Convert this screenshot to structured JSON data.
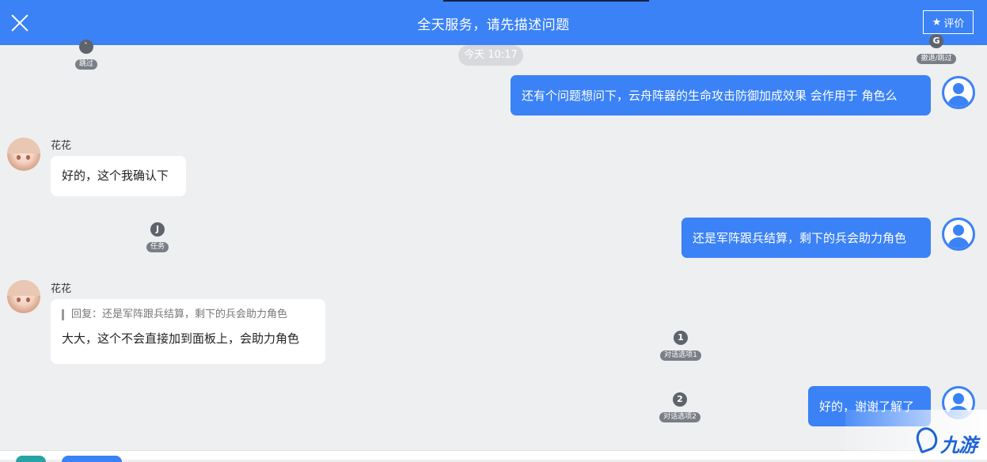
{
  "header": {
    "title": "全天服务，请先描述问题",
    "rate_label": "评价",
    "accent": "#3b82f6"
  },
  "timestamp": "今天 10:17",
  "markers": [
    {
      "key": "`",
      "label": "跳过"
    },
    {
      "key": "G",
      "label": "撤退/跳过"
    },
    {
      "key": "J",
      "label": "任务"
    },
    {
      "key": "1",
      "label": "对话选项1"
    },
    {
      "key": "2",
      "label": "对话选项2"
    }
  ],
  "messages": [
    {
      "sender": "user",
      "text": "还有个问题想问下，云舟阵器的生命攻击防御加成效果 会作用于 角色么"
    },
    {
      "sender": "agent",
      "name": "花花",
      "text": "好的，这个我确认下"
    },
    {
      "sender": "user",
      "text": "还是军阵跟兵结算，剩下的兵会助力角色"
    },
    {
      "sender": "agent",
      "name": "花花",
      "quote": "回复：还是军阵跟兵结算，剩下的兵会助力角色",
      "text": "大大，这个不会直接加到面板上，会助力角色"
    },
    {
      "sender": "user",
      "text": "好的，谢谢了解了"
    }
  ],
  "watermark": "九游"
}
